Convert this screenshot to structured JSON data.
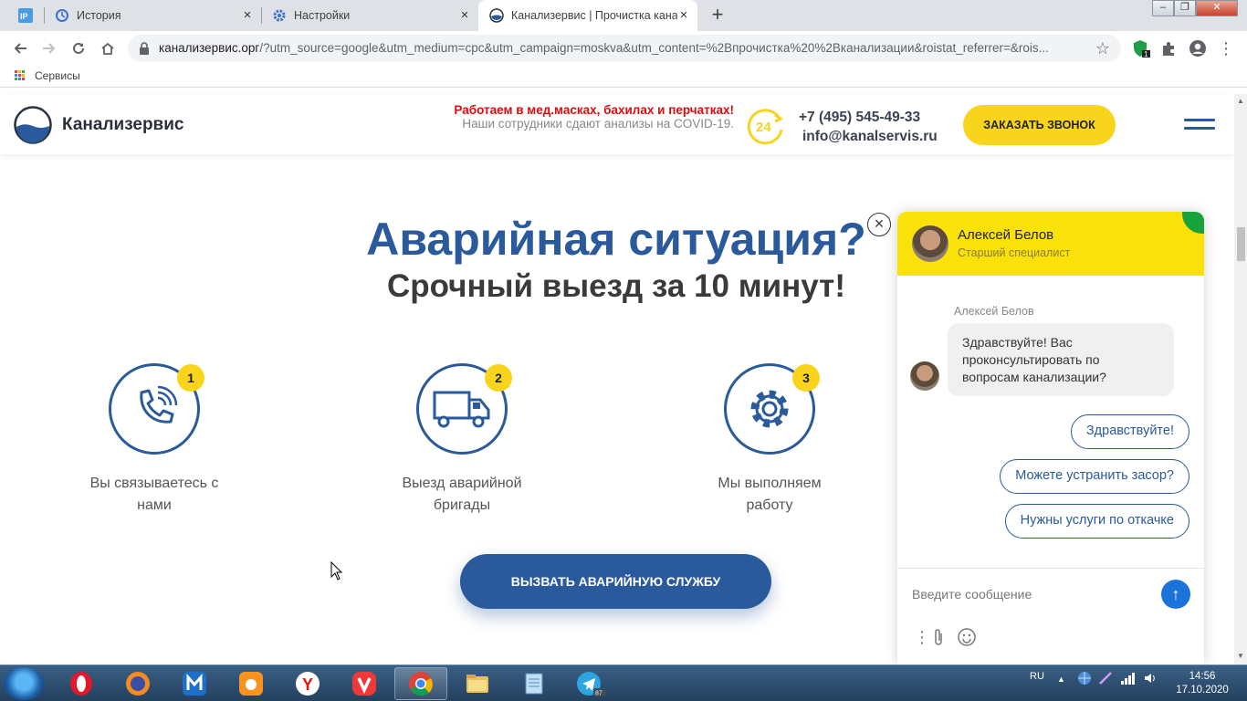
{
  "browser": {
    "tabs": [
      {
        "title": "",
        "favicon": "ip-icon"
      },
      {
        "title": "История",
        "favicon": "history-icon"
      },
      {
        "title": "Настройки",
        "favicon": "settings-gear-icon"
      },
      {
        "title": "Канализервис | Прочистка канал",
        "favicon": "site-logo-icon",
        "active": true
      }
    ],
    "url_host": "канализервис.орг",
    "url_rest": "/?utm_source=google&utm_medium=cpc&utm_campaign=moskva&utm_content=%2Bпрочистка%20%2Bканализации&roistat_referrer=&rois...",
    "bookmarks": [
      {
        "label": "Сервисы"
      }
    ],
    "extension_badge": "1"
  },
  "site": {
    "brand": "Канализервис",
    "notice_red": "Работаем в мед.масках, бахилах и перчатках!",
    "notice_grey": "Наши сотрудники сдают анализы на COVID-19.",
    "badge_24": "24",
    "phone": "+7 (495) 545-49-33",
    "email": "info@kanalservis.ru",
    "call_button": "ЗАКАЗАТЬ ЗВОНОК"
  },
  "main": {
    "title": "Аварийная ситуация?",
    "subtitle": "Срочный выезд за 10 минут!",
    "steps": [
      {
        "num": "1",
        "label": "Вы связываетесь с нами",
        "icon": "phone-ringing-icon"
      },
      {
        "num": "2",
        "label": "Выезд аварийной бригады",
        "icon": "truck-icon"
      },
      {
        "num": "3",
        "label": "Мы выполняем работу",
        "icon": "gear-icon"
      }
    ],
    "cta": "ВЫЗВАТЬ АВАРИЙНУЮ СЛУЖБУ"
  },
  "chat": {
    "agent_name": "Алексей Белов",
    "agent_role": "Старший специалист",
    "message_author": "Алексей Белов",
    "message": "Здравствуйте! Вас проконсультировать по вопросам канализации?",
    "quick_replies": [
      "Здравствуйте!",
      "Можете устранить засор?",
      "Нужны услуги по откачке"
    ],
    "input_placeholder": "Введите сообщение"
  },
  "taskbar": {
    "apps": [
      "opera",
      "firefox",
      "maxthon",
      "uc-browser",
      "yandex",
      "vivaldi",
      "chrome",
      "explorer",
      "notepad",
      "telegram"
    ],
    "telegram_badge": "87",
    "lang": "RU",
    "time": "14:56",
    "date": "17.10.2020"
  },
  "colors": {
    "brand_blue": "#2a5a9b",
    "accent_yellow": "#f9d41c",
    "alert_red": "#e00b0b",
    "chat_header": "#fbe10a"
  }
}
